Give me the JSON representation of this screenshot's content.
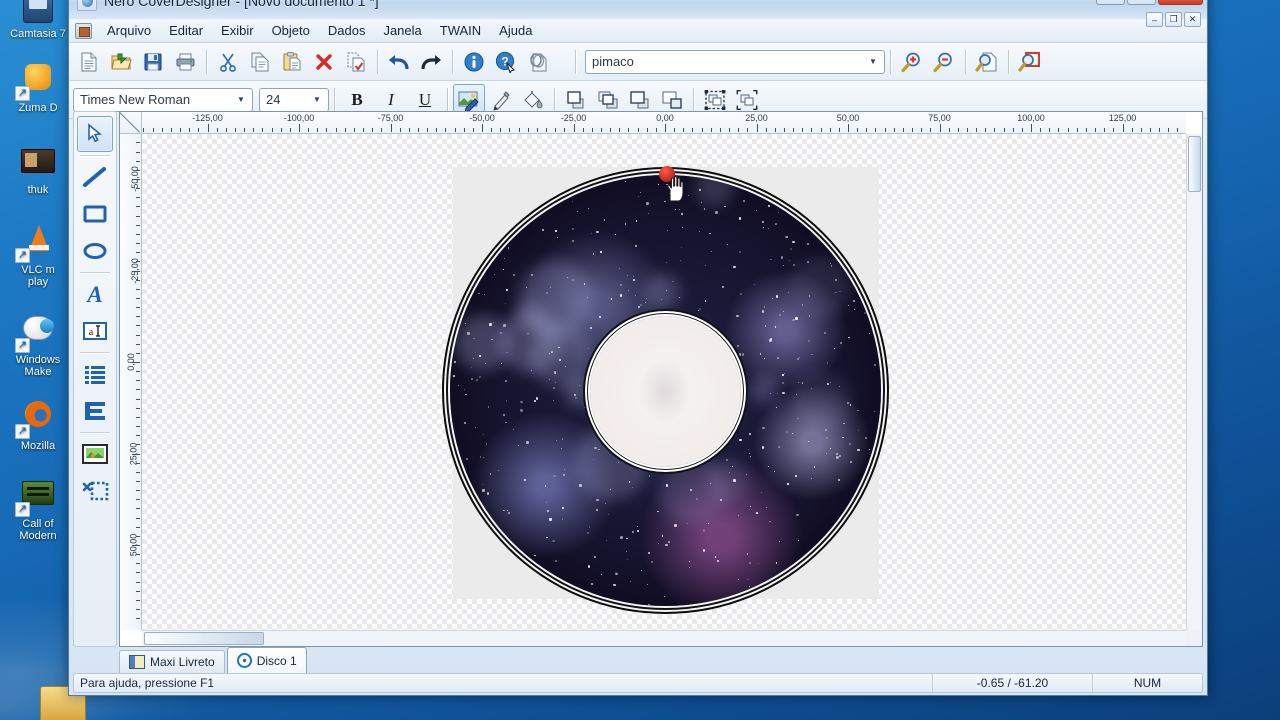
{
  "desktop": {
    "icons": [
      {
        "label": "Camtasia 7",
        "icon": "camtasia-icon"
      },
      {
        "label": "Zuma D",
        "icon": "zuma-deluxe-icon"
      },
      {
        "label": "thuk",
        "icon": "thuk-icon"
      },
      {
        "label": "VLC m\nplay",
        "icon": "vlc-media-player-icon"
      },
      {
        "label": "Windows\nMake",
        "icon": "windows-movie-maker-icon"
      },
      {
        "label": "Mozilla",
        "icon": "mozilla-firefox-icon"
      },
      {
        "label": "Call of\nModern",
        "icon": "call-of-duty-icon"
      }
    ]
  },
  "window": {
    "title": "Nero CoverDesigner - [Novo documento 1 *]",
    "buttons": {
      "minimize": "–",
      "maximize": "❐",
      "close": "✕"
    }
  },
  "mdi_buttons": {
    "minimize": "–",
    "restore": "❐",
    "close": "✕"
  },
  "menu": {
    "items": [
      "Arquivo",
      "Editar",
      "Exibir",
      "Objeto",
      "Dados",
      "Janela",
      "TWAIN",
      "Ajuda"
    ]
  },
  "toolbar_main": {
    "buttons": [
      {
        "name": "new-document",
        "icon": "new-document-icon"
      },
      {
        "name": "open",
        "icon": "open-folder-icon"
      },
      {
        "name": "save",
        "icon": "save-floppy-icon"
      },
      {
        "name": "print",
        "icon": "printer-icon"
      },
      {
        "name": "cut",
        "icon": "scissors-icon"
      },
      {
        "name": "copy",
        "icon": "copy-icon"
      },
      {
        "name": "paste",
        "icon": "clipboard-paste-icon"
      },
      {
        "name": "delete",
        "icon": "red-x-icon"
      },
      {
        "name": "select-all",
        "icon": "select-document-icon"
      },
      {
        "name": "undo",
        "icon": "undo-arrow-icon"
      },
      {
        "name": "redo",
        "icon": "redo-arrow-icon"
      },
      {
        "name": "document-info",
        "icon": "info-icon"
      },
      {
        "name": "context-help",
        "icon": "help-question-icon"
      },
      {
        "name": "nero-express",
        "icon": "discs-icon"
      }
    ],
    "document_type": "pimaco",
    "zoom_buttons": [
      {
        "name": "zoom-in",
        "icon": "magnifier-plus-icon"
      },
      {
        "name": "zoom-out",
        "icon": "magnifier-minus-icon"
      },
      {
        "name": "zoom-page",
        "icon": "magnifier-page-icon"
      },
      {
        "name": "zoom-selection",
        "icon": "magnifier-selection-icon"
      }
    ]
  },
  "toolbar_format": {
    "font_family": "Times New Roman",
    "font_size": "24",
    "bold": "B",
    "italic": "I",
    "underline": "U",
    "buttons": [
      {
        "name": "image-properties",
        "icon": "image-brush-icon"
      },
      {
        "name": "pen-color",
        "icon": "pencil-icon"
      },
      {
        "name": "fill-color",
        "icon": "paint-bucket-icon"
      },
      {
        "name": "bring-to-front",
        "icon": "bring-to-front-icon"
      },
      {
        "name": "bring-forward",
        "icon": "bring-forward-icon"
      },
      {
        "name": "send-backward",
        "icon": "send-backward-icon"
      },
      {
        "name": "send-to-back",
        "icon": "send-to-back-icon"
      },
      {
        "name": "group",
        "icon": "group-icon"
      },
      {
        "name": "ungroup",
        "icon": "ungroup-icon"
      }
    ]
  },
  "tool_palette": {
    "tools": [
      {
        "name": "selection-tool",
        "icon": "arrow-cursor-icon",
        "active": true
      },
      {
        "name": "line-tool",
        "icon": "line-icon",
        "active": false
      },
      {
        "name": "rectangle-tool",
        "icon": "rectangle-icon",
        "active": false
      },
      {
        "name": "ellipse-tool",
        "icon": "ellipse-icon",
        "active": false
      },
      {
        "name": "artistic-text-tool",
        "icon": "letter-a-icon",
        "active": false
      },
      {
        "name": "text-box-tool",
        "icon": "text-cursor-icon",
        "active": false
      },
      {
        "name": "field-list-tool",
        "icon": "list-lines-icon",
        "active": false
      },
      {
        "name": "track-list-tool",
        "icon": "track-list-icon",
        "active": false
      },
      {
        "name": "image-tool",
        "icon": "picture-icon",
        "active": false
      },
      {
        "name": "crop-tool",
        "icon": "crop-selection-icon",
        "active": false
      }
    ]
  },
  "rulers": {
    "horizontal_labels": [
      "-125,00",
      "-100,00",
      "-75,00",
      "-50,00",
      "-25,00",
      "0,00",
      "25,00",
      "50,00",
      "75,00",
      "100,00",
      "125,00"
    ],
    "vertical_labels": [
      "-50,00",
      "-25,00",
      "0,00",
      "25,00",
      "50,00"
    ]
  },
  "canvas": {
    "document_element": "cd-disc-artwork",
    "artwork_description": "galaxy-space-image"
  },
  "page_tabs": [
    {
      "label": "Maxi Livreto",
      "icon": "booklet-icon",
      "active": false
    },
    {
      "label": "Disco 1",
      "icon": "disc-icon",
      "active": true
    }
  ],
  "status_bar": {
    "help": "Para ajuda, pressione F1",
    "coordinates": "-0.65 / -61.20",
    "num_lock": "NUM"
  },
  "colors": {
    "title_accent": "#cfe0f2",
    "close_button": "#cb3a26",
    "handle": "#b01008",
    "tool_blue": "#1f5fa8",
    "desktop": "#1668b4"
  }
}
